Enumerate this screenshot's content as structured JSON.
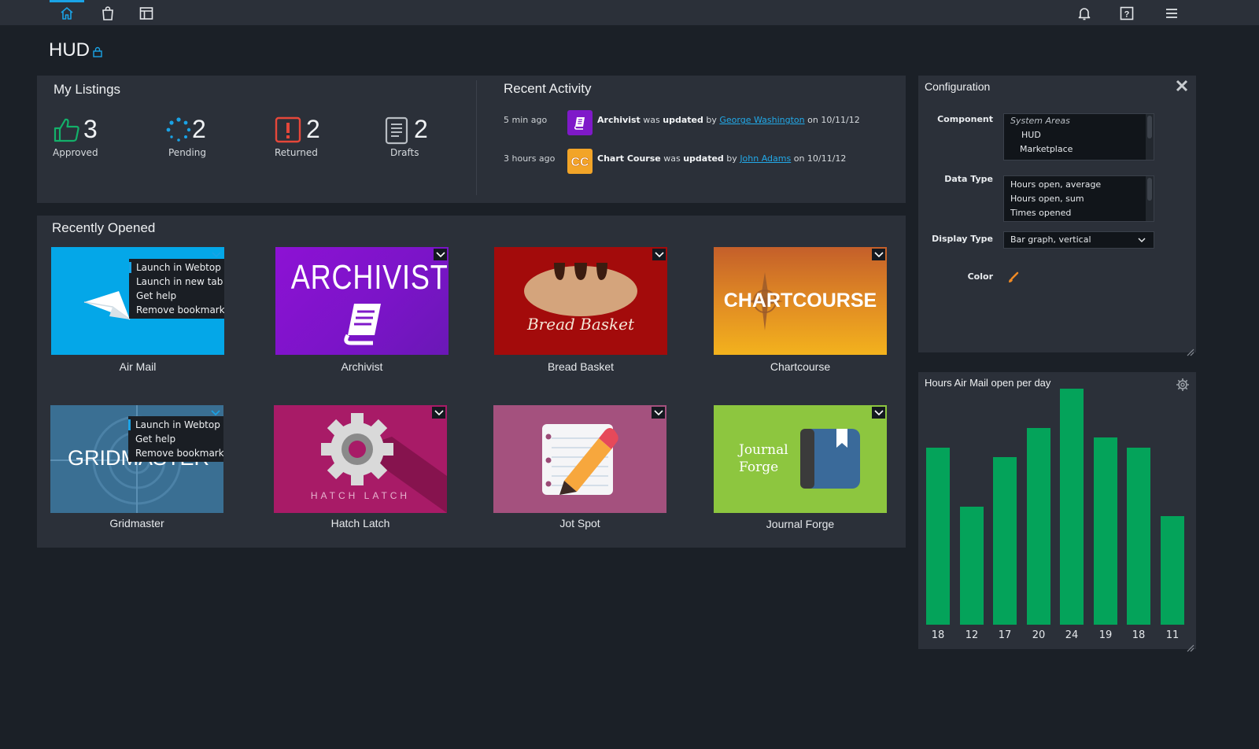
{
  "topbar": {
    "icons": [
      "home-icon",
      "marketplace-bag-icon",
      "dashboard-layout-icon",
      "bell-icon",
      "help-icon",
      "hamburger-menu-icon"
    ]
  },
  "page": {
    "title": "HUD"
  },
  "my_listings": {
    "title": "My Listings",
    "stats": [
      {
        "count": "3",
        "label": "Approved"
      },
      {
        "count": "2",
        "label": "Pending"
      },
      {
        "count": "2",
        "label": "Returned"
      },
      {
        "count": "2",
        "label": "Drafts"
      }
    ]
  },
  "recent_activity": {
    "title": "Recent Activity",
    "items": [
      {
        "time": "5 min ago",
        "app": "Archivist",
        "was": " was ",
        "action": "updated",
        "by": " by ",
        "user": "George Washington",
        "on": " on 10/11/12"
      },
      {
        "time": "3 hours ago",
        "app": "Chart Course",
        "was": " was ",
        "action": "updated",
        "by": " by ",
        "user": "John Adams",
        "on": " on 10/11/12"
      }
    ]
  },
  "recently_opened": {
    "title": "Recently Opened",
    "tiles": [
      {
        "name": "Air Mail"
      },
      {
        "name": "Archivist",
        "banner": "ARCHIVIST"
      },
      {
        "name": "Bread Basket",
        "banner": "Bread Basket"
      },
      {
        "name": "Chartcourse",
        "banner": "CHARTCOURSE"
      },
      {
        "name": "Gridmaster",
        "banner": "GRIDMASTER"
      },
      {
        "name": "Hatch Latch",
        "banner": "HATCH LATCH"
      },
      {
        "name": "Jot Spot"
      },
      {
        "name": "Journal Forge",
        "banner_line1": "Journal",
        "banner_line2": "Forge"
      }
    ],
    "menu_airmail": [
      "Launch in Webtop",
      "Launch in new tab",
      "Get help",
      "Remove bookmark"
    ],
    "menu_gridmaster": [
      "Launch in Webtop",
      "Get help",
      "Remove bookmark"
    ]
  },
  "configuration": {
    "title": "Configuration",
    "component_label": "Component",
    "component_group": "System Areas",
    "component_options": [
      "HUD",
      "Marketplace"
    ],
    "data_type_label": "Data Type",
    "data_type_options": [
      "Hours open, average",
      "Hours open, sum",
      "Times opened"
    ],
    "display_type_label": "Display Type",
    "display_type_value": "Bar graph, vertical",
    "color_label": "Color",
    "color_value": "#f08a24"
  },
  "chart_data": {
    "type": "bar",
    "title": "Hours Air Mail open per day",
    "categories": [
      "18",
      "12",
      "17",
      "20",
      "24",
      "19",
      "18",
      "11"
    ],
    "values": [
      18,
      12,
      17,
      20,
      24,
      19,
      18,
      11
    ],
    "ylim": [
      0,
      24
    ],
    "color": "#04a35a",
    "grid": false
  },
  "colors": {
    "accent": "#1aa3e6",
    "panel": "#2b3039",
    "background": "#1b2027",
    "bar": "#04a35a"
  }
}
